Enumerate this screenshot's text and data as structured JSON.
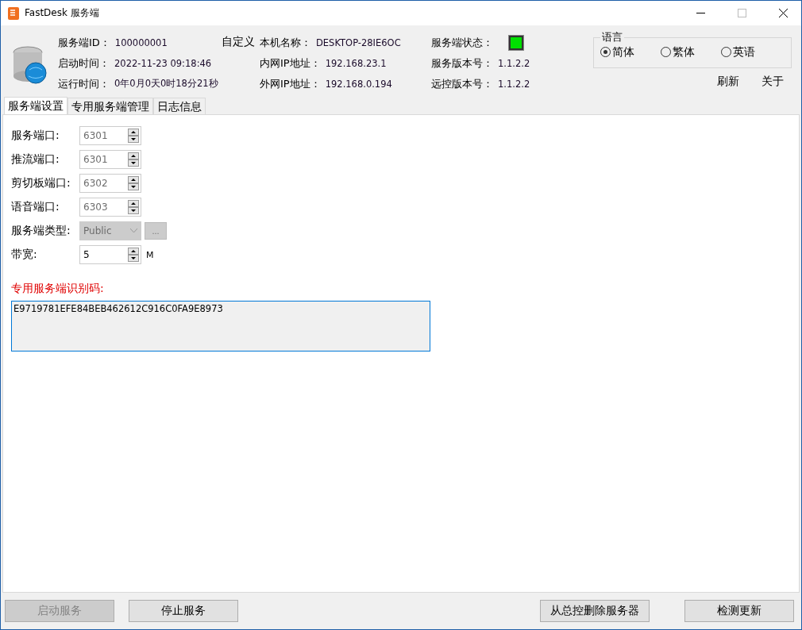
{
  "window": {
    "title": "FastDesk 服务端"
  },
  "info_columns": [
    {
      "items": [
        {
          "label": "服务端ID：",
          "value": "100000001"
        },
        {
          "label": "启动时间：",
          "value": "2022-11-23 09:18:46"
        },
        {
          "label": "运行时间：",
          "value": "0年0月0天0时18分21秒"
        }
      ],
      "link": "自定义"
    },
    {
      "items": [
        {
          "label": "本机名称：",
          "value": "DESKTOP-28IE6OC"
        },
        {
          "label": "内网IP地址：",
          "value": "192.168.23.1"
        },
        {
          "label": "外网IP地址：",
          "value": "192.168.0.194"
        }
      ]
    },
    {
      "items": [
        {
          "label": "服务端状态：",
          "kind": "status",
          "on": true
        },
        {
          "label": "服务版本号：",
          "value": "1.1.2.2"
        },
        {
          "label": "远控版本号：",
          "value": "1.1.2.2"
        }
      ]
    }
  ],
  "language": {
    "title": "语言",
    "options": [
      {
        "label": "简体",
        "selected": true
      },
      {
        "label": "繁体",
        "selected": false
      },
      {
        "label": "英语",
        "selected": false
      }
    ]
  },
  "header_links": [
    "刷新",
    "关于"
  ],
  "tabs": [
    {
      "label": "服务端设置",
      "selected": true
    },
    {
      "label": "专用服务端管理",
      "selected": false
    },
    {
      "label": "日志信息",
      "selected": false
    }
  ],
  "settings": [
    {
      "kind": "spin",
      "label": "服务端口:",
      "value": "6301",
      "disabled": true
    },
    {
      "kind": "spin",
      "label": "推流端口:",
      "value": "6301",
      "disabled": true
    },
    {
      "kind": "spin",
      "label": "剪切板端口:",
      "value": "6302",
      "disabled": true
    },
    {
      "kind": "spin",
      "label": "语音端口:",
      "value": "6303",
      "disabled": true
    },
    {
      "kind": "select",
      "label": "服务端类型:",
      "value": "Public",
      "disabled": true,
      "extra": "..."
    },
    {
      "kind": "spin",
      "label": "带宽:",
      "value": "5",
      "disabled": false,
      "unit": "M"
    }
  ],
  "id_code": {
    "label": "专用服务端识别码:",
    "value": "E9719781EFE84BEB462612C916C0FA9E8973"
  },
  "buttons": [
    {
      "label": "启动服务",
      "disabled": true
    },
    {
      "label": "停止服务",
      "disabled": false
    },
    {
      "label": "从总控删除服务器",
      "disabled": false
    },
    {
      "label": "检测更新",
      "disabled": false
    }
  ]
}
